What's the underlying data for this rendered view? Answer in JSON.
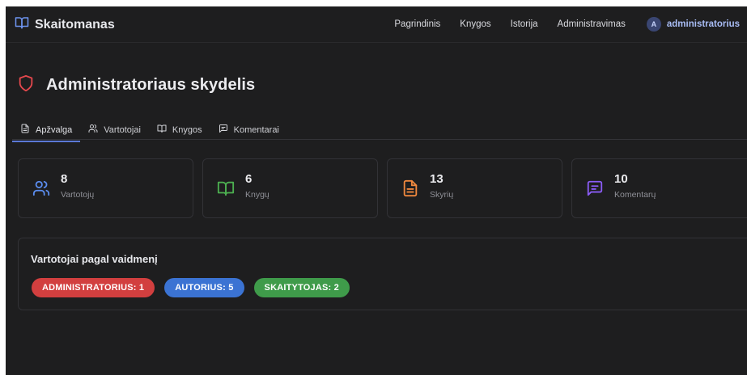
{
  "brand": {
    "name": "Skaitomanas",
    "icon": "book-open-icon"
  },
  "nav": {
    "links": [
      "Pagrindinis",
      "Knygos",
      "Istorija",
      "Administravimas"
    ],
    "user": {
      "initial": "A",
      "name": "administratorius"
    }
  },
  "page": {
    "title": "Administratoriaus skydelis",
    "icon": "shield-icon"
  },
  "tabs": [
    {
      "label": "Apžvalga",
      "icon": "document-icon",
      "active": true
    },
    {
      "label": "Vartotojai",
      "icon": "users-icon",
      "active": false
    },
    {
      "label": "Knygos",
      "icon": "book-open-icon",
      "active": false
    },
    {
      "label": "Komentarai",
      "icon": "message-icon",
      "active": false
    }
  ],
  "stats": [
    {
      "value": "8",
      "label": "Vartotojų",
      "icon": "users-icon",
      "color": "#5b8def"
    },
    {
      "value": "6",
      "label": "Knygų",
      "icon": "book-open-icon",
      "color": "#4caf50"
    },
    {
      "value": "13",
      "label": "Skyrių",
      "icon": "file-text-icon",
      "color": "#f0883e"
    },
    {
      "value": "10",
      "label": "Komentarų",
      "icon": "message-icon",
      "color": "#8b5cf6"
    }
  ],
  "roles": {
    "title": "Vartotojai pagal vaidmenį",
    "badges": [
      {
        "label": "ADMINISTRATORIUS: 1",
        "color": "#d23f3f"
      },
      {
        "label": "AUTORIUS: 5",
        "color": "#3b73d3"
      },
      {
        "label": "SKAITYTOJAS: 2",
        "color": "#3f9b4a"
      }
    ]
  },
  "colors": {
    "background": "#1e1e1f",
    "accent": "#5b78d6",
    "shield": "#e5484d"
  }
}
